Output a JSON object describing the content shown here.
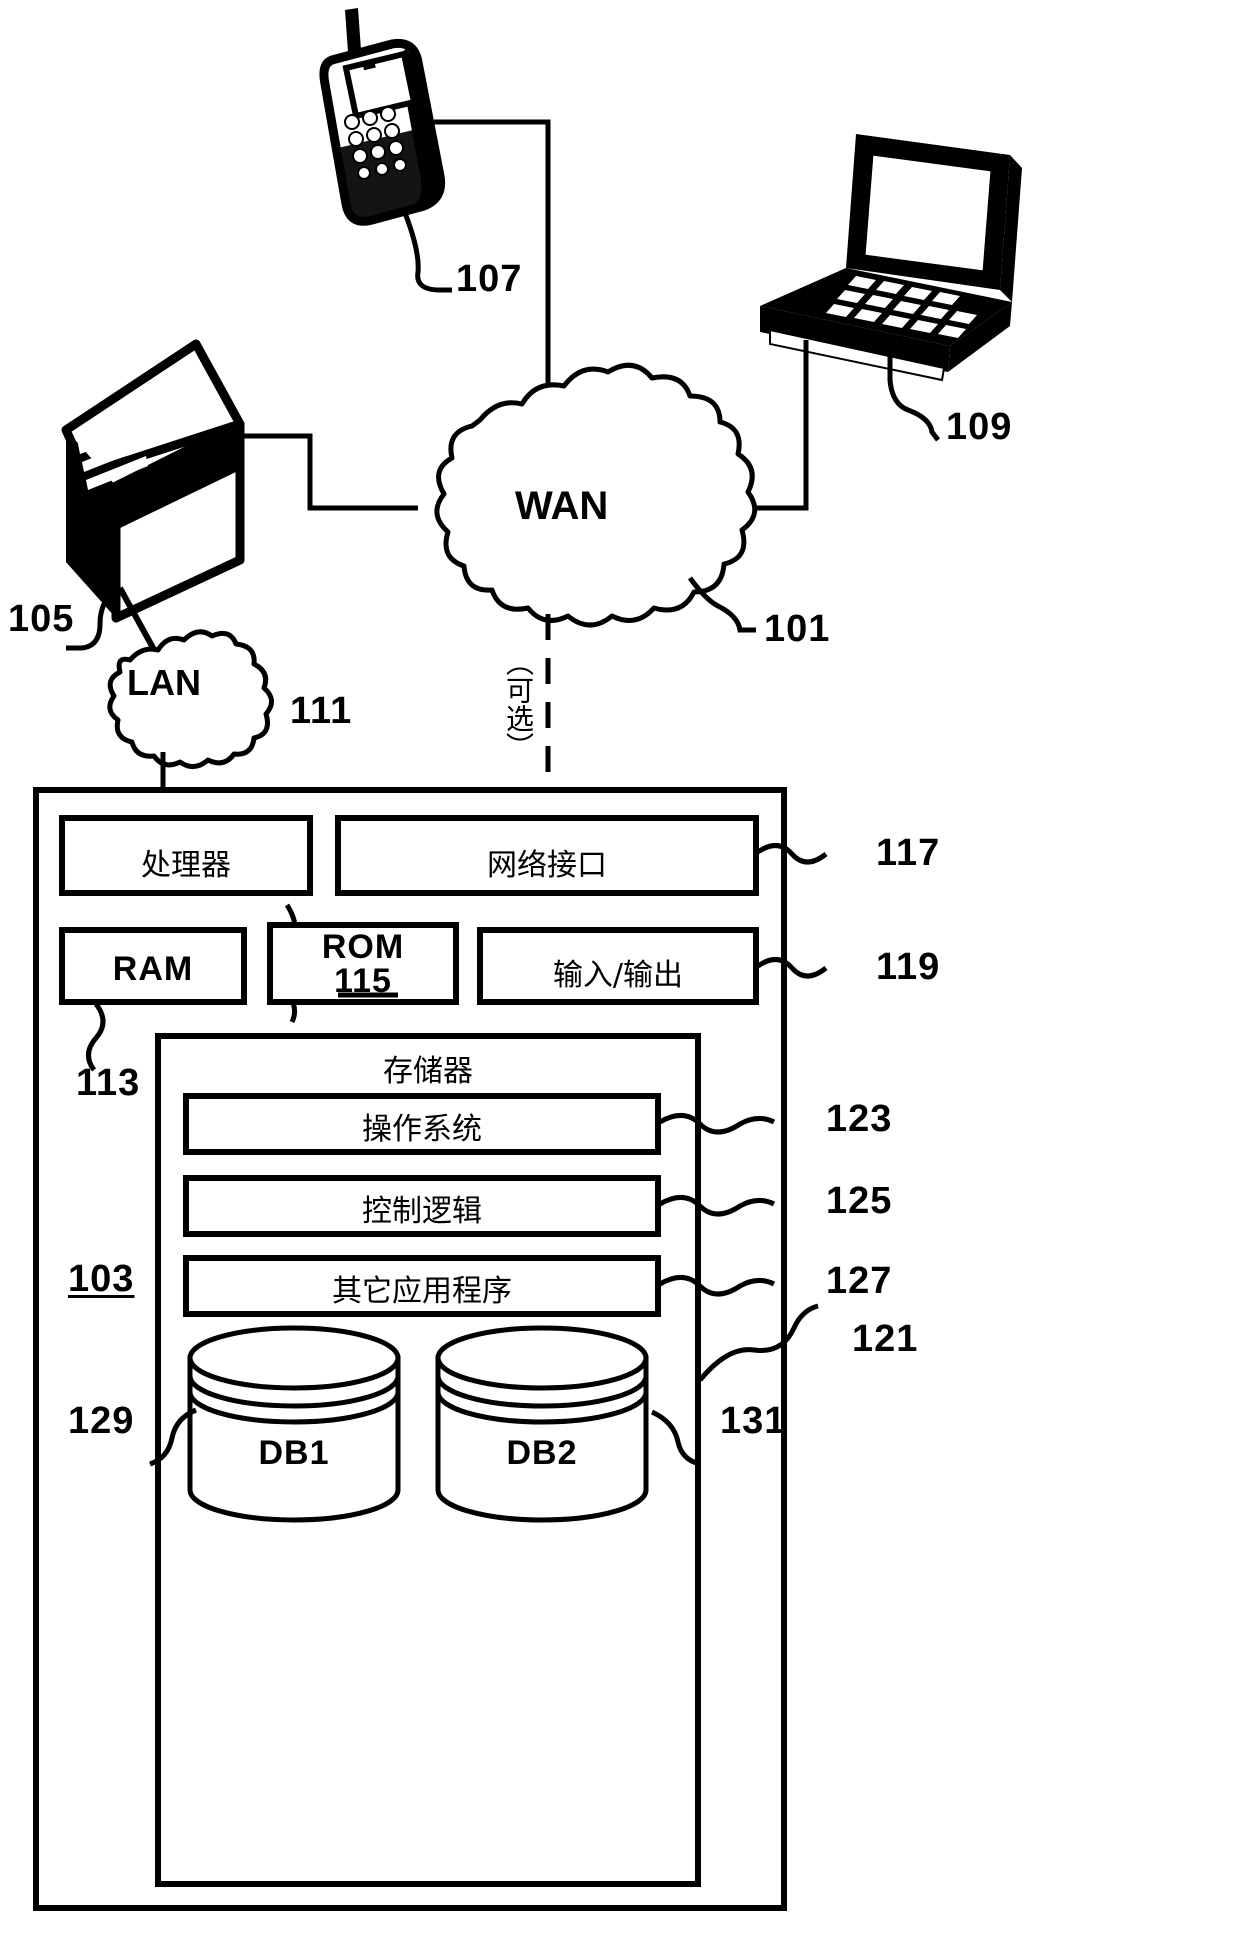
{
  "figure": {
    "title": "Network architecture block diagram",
    "stroke_color": "#000000",
    "background_color": "#ffffff"
  },
  "clouds": [
    {
      "name": "wan-cloud",
      "label": "WAN",
      "ref": "101"
    },
    {
      "name": "lan-cloud",
      "label": "LAN",
      "ref": ""
    }
  ],
  "devices": [
    {
      "name": "mobile-phone",
      "ref": "107"
    },
    {
      "name": "laptop-computer",
      "ref": "109"
    },
    {
      "name": "server-tower",
      "ref": "105"
    }
  ],
  "annotations": {
    "optional_link_label": "（可选）"
  },
  "reference_numerals": {
    "phone": "107",
    "laptop": "109",
    "server": "105",
    "wan": "101",
    "processor": "111",
    "ram": "113",
    "rom": "115",
    "network_interface": "117",
    "input_output": "119",
    "memory": "121",
    "operating_system": "123",
    "control_logic": "125",
    "other_applications": "127",
    "db1": "129",
    "db2": "131",
    "computing_device": "103"
  },
  "computing_device": {
    "ref": "103",
    "top_row": [
      {
        "name": "processor-box",
        "label": "处理器",
        "ref": "111"
      },
      {
        "name": "network-interface-box",
        "label": "网络接口",
        "ref": "117"
      }
    ],
    "second_row": [
      {
        "name": "ram-box",
        "label": "RAM",
        "ref": "113",
        "latin": true
      },
      {
        "name": "rom-box",
        "label": "ROM",
        "ref": "115",
        "latin": true,
        "inner_ref": "115"
      },
      {
        "name": "input-output-box",
        "label": "输入/输出",
        "ref": "119"
      }
    ],
    "memory": {
      "name": "memory-box",
      "label": "存储器",
      "ref": "121",
      "modules": [
        {
          "name": "operating-system-box",
          "label": "操作系统",
          "ref": "123"
        },
        {
          "name": "control-logic-box",
          "label": "控制逻辑",
          "ref": "125"
        },
        {
          "name": "other-applications-box",
          "label": "其它应用程序",
          "ref": "127"
        }
      ],
      "databases": [
        {
          "name": "database-db1",
          "label": "DB1",
          "ref": "129"
        },
        {
          "name": "database-db2",
          "label": "DB2",
          "ref": "131"
        }
      ]
    }
  }
}
